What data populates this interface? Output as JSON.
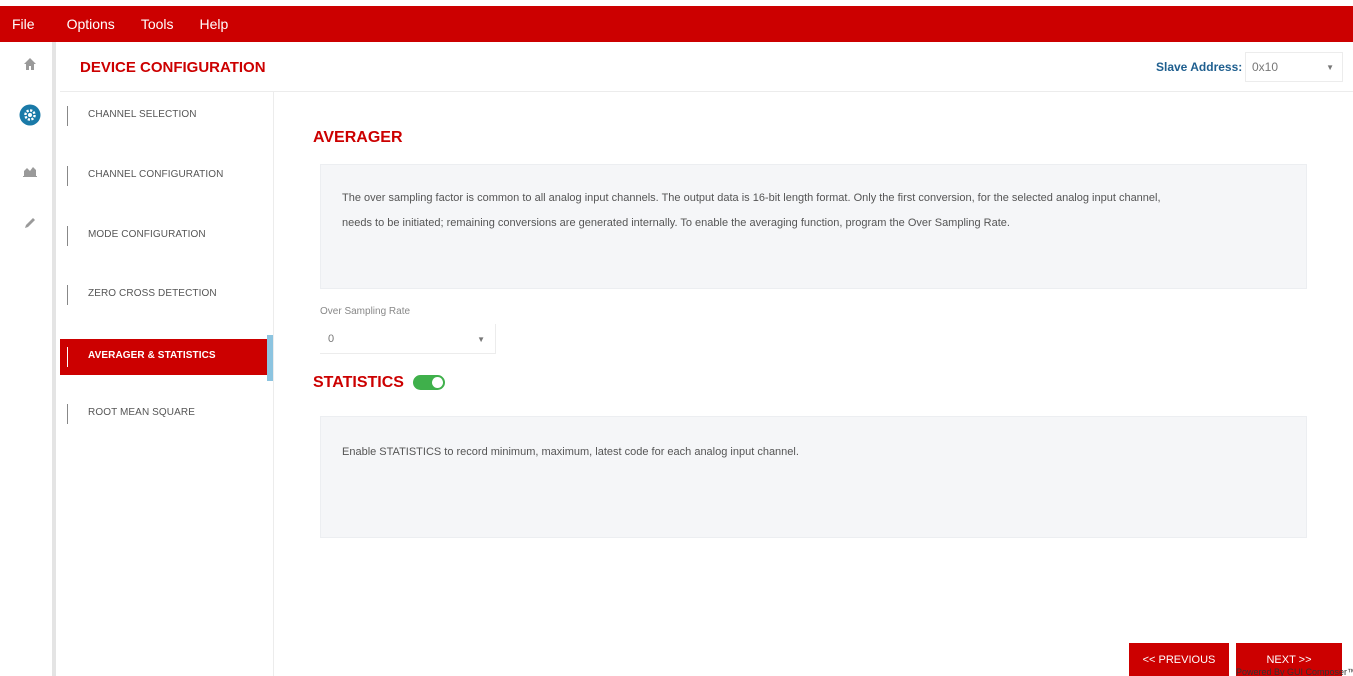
{
  "menu": {
    "file": "File",
    "options": "Options",
    "tools": "Tools",
    "help": "Help"
  },
  "rail": {
    "icons": [
      "home-icon",
      "gear-icon",
      "chart-icon",
      "pencil-icon"
    ],
    "active_color": "#1a7aa8"
  },
  "header": {
    "title": "DEVICE CONFIGURATION",
    "slave_label": "Slave Address:",
    "slave_value": "0x10"
  },
  "sidebar": {
    "items": [
      {
        "label": "CHANNEL SELECTION"
      },
      {
        "label": "CHANNEL CONFIGURATION"
      },
      {
        "label": "MODE CONFIGURATION"
      },
      {
        "label": "ZERO CROSS DETECTION"
      },
      {
        "label": "AVERAGER & STATISTICS"
      },
      {
        "label": "ROOT MEAN SQUARE"
      }
    ],
    "active_index": 4
  },
  "averager": {
    "title": "AVERAGER",
    "desc_line1": "The over sampling factor is common to all analog input channels. The output data is 16-bit length format. Only the first conversion, for the selected analog input channel,",
    "desc_line2": "needs to be initiated; remaining conversions are generated internally. To enable the averaging function, program the Over Sampling Rate.",
    "osr_label": "Over Sampling Rate",
    "osr_value": "0"
  },
  "statistics": {
    "title": "STATISTICS",
    "enabled": true,
    "desc": "Enable STATISTICS to record minimum, maximum, latest code for each analog input channel."
  },
  "footer": {
    "prev_label": "<< PREVIOUS",
    "next_label": "NEXT >>",
    "powered": "Powered By GUI Composer™"
  },
  "colors": {
    "brand_red": "#cc0000",
    "toggle_green": "#3fb04b",
    "slave_blue": "#1f5f8f",
    "indicator_blue": "#8cc4e0"
  }
}
